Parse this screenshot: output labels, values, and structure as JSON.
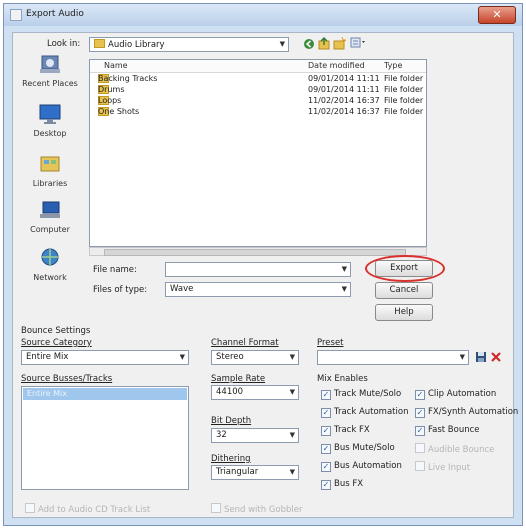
{
  "window": {
    "title": "Export Audio",
    "close": "✕"
  },
  "top": {
    "lookin_label": "Look in:",
    "lookin_value": "Audio Library"
  },
  "places": [
    {
      "label": "Recent Places",
      "icon": "recent-places-icon"
    },
    {
      "label": "Desktop",
      "icon": "desktop-icon"
    },
    {
      "label": "Libraries",
      "icon": "libraries-icon"
    },
    {
      "label": "Computer",
      "icon": "computer-icon"
    },
    {
      "label": "Network",
      "icon": "network-icon"
    }
  ],
  "files": {
    "columns": [
      "Name",
      "Date modified",
      "Type"
    ],
    "rows": [
      {
        "name": "Backing Tracks",
        "date": "09/01/2014 11:11",
        "type": "File folder"
      },
      {
        "name": "Drums",
        "date": "09/01/2014 11:11",
        "type": "File folder"
      },
      {
        "name": "Loops",
        "date": "11/02/2014 16:37",
        "type": "File folder"
      },
      {
        "name": "One Shots",
        "date": "11/02/2014 16:37",
        "type": "File folder"
      }
    ]
  },
  "filename": {
    "label": "File name:",
    "value": ""
  },
  "filetype": {
    "label": "Files of type:",
    "value": "Wave"
  },
  "buttons": {
    "export": "Export",
    "cancel": "Cancel",
    "help": "Help"
  },
  "bounce": {
    "section_title": "Bounce Settings",
    "source_category_label": "Source Category",
    "source_category_value": "Entire Mix",
    "source_busses_label": "Source Busses/Tracks",
    "source_busses_items": [
      "Entire Mix"
    ],
    "channel_format_label": "Channel Format",
    "channel_format_value": "Stereo",
    "sample_rate_label": "Sample Rate",
    "sample_rate_value": "44100",
    "bit_depth_label": "Bit Depth",
    "bit_depth_value": "32",
    "dithering_label": "Dithering",
    "dithering_value": "Triangular",
    "preset_label": "Preset",
    "preset_value": "",
    "mix_enables_label": "Mix Enables",
    "mix_left": [
      {
        "label": "Track Mute/Solo",
        "checked": true,
        "enabled": true
      },
      {
        "label": "Track Automation",
        "checked": true,
        "enabled": true
      },
      {
        "label": "Track FX",
        "checked": true,
        "enabled": true
      },
      {
        "label": "Bus Mute/Solo",
        "checked": true,
        "enabled": true
      },
      {
        "label": "Bus Automation",
        "checked": true,
        "enabled": true
      },
      {
        "label": "Bus FX",
        "checked": true,
        "enabled": true
      }
    ],
    "mix_right": [
      {
        "label": "Clip Automation",
        "checked": true,
        "enabled": true
      },
      {
        "label": "FX/Synth Automation",
        "checked": true,
        "enabled": true
      },
      {
        "label": "Fast Bounce",
        "checked": true,
        "enabled": true
      },
      {
        "label": "Audible Bounce",
        "checked": false,
        "enabled": false
      },
      {
        "label": "Live Input",
        "checked": false,
        "enabled": false
      }
    ],
    "add_cd_label": "Add to Audio CD Track List",
    "send_gobbler_label": "Send with Gobbler"
  }
}
